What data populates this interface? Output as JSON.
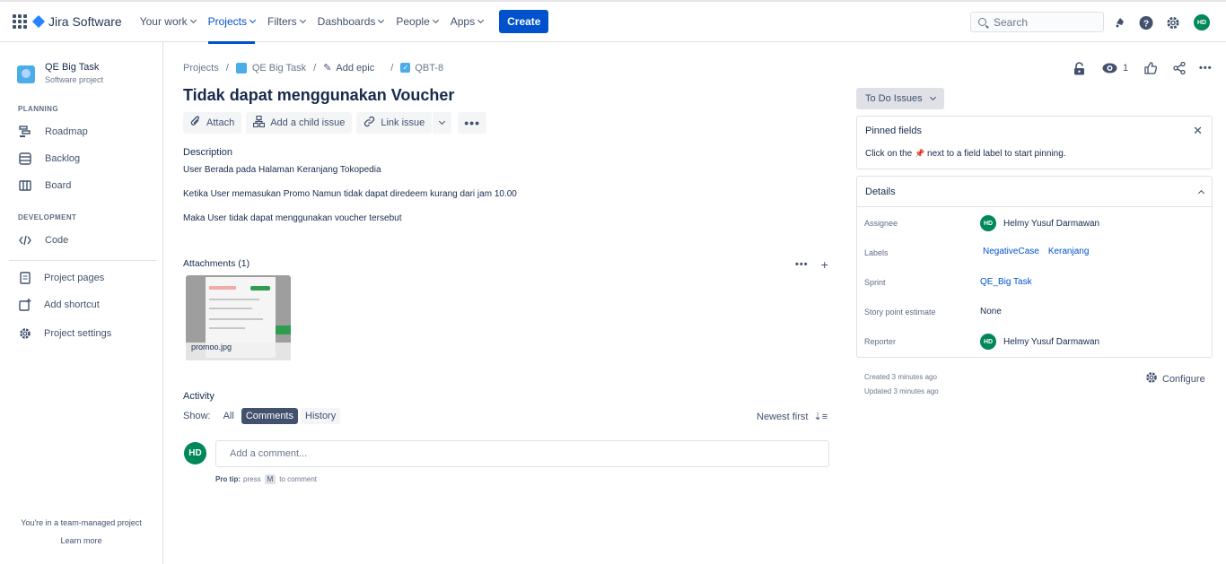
{
  "nav": {
    "product": "Jira Software",
    "items": [
      "Your work",
      "Projects",
      "Filters",
      "Dashboards",
      "People",
      "Apps"
    ],
    "create_label": "Create",
    "search_placeholder": "Search",
    "user_initials": "HD"
  },
  "sidebar": {
    "project_name": "QE Big Task",
    "project_type": "Software project",
    "planning_header": "PLANNING",
    "planning_items": [
      "Roadmap",
      "Backlog",
      "Board"
    ],
    "development_header": "DEVELOPMENT",
    "development_items": [
      "Code"
    ],
    "other_items": [
      "Project pages",
      "Add shortcut",
      "Project settings"
    ],
    "footer_text": "You're in a team-managed project",
    "learn_more": "Learn more"
  },
  "breadcrumb": {
    "root": "Projects",
    "project": "QE Big Task",
    "epic": "Add epic",
    "issue_key": "QBT-8"
  },
  "issue": {
    "title": "Tidak dapat menggunakan Voucher",
    "toolbar": [
      "Attach",
      "Add a child issue",
      "Link issue"
    ],
    "description_label": "Description",
    "description_lines": [
      "User Berada pada Halaman Keranjang Tokopedia",
      "Ketika User memasukan Promo Namun tidak dapat diredeem kurang dari jam 10.00",
      "Maka User tidak dapat menggunakan voucher tersebut"
    ],
    "attachments_label": "Attachments (1)",
    "attachment_file": "promoo.jpg"
  },
  "activity": {
    "label": "Activity",
    "show_label": "Show:",
    "filters": [
      "All",
      "Comments",
      "History"
    ],
    "selected_filter": "Comments",
    "sort_label": "Newest first",
    "comment_placeholder": "Add a comment...",
    "protip_bold": "Pro tip:",
    "protip_press": "press",
    "protip_key": "M",
    "protip_rest": "to comment"
  },
  "right": {
    "watchers_count": "1",
    "status_label": "To Do Issues",
    "pinned_title": "Pinned fields",
    "pinned_hint_pre": "Click on the",
    "pinned_hint_post": "next to a field label to start pinning.",
    "details_title": "Details",
    "fields": {
      "assignee_label": "Assignee",
      "assignee": "Helmy Yusuf Darmawan",
      "labels_label": "Labels",
      "labels": [
        "NegativeCase",
        "Keranjang"
      ],
      "sprint_label": "Sprint",
      "sprint": "QE_Big Task",
      "story_points_label": "Story point estimate",
      "story_points": "None",
      "reporter_label": "Reporter",
      "reporter": "Helmy Yusuf Darmawan",
      "avatar_initials": "HD"
    },
    "created": "Created 3 minutes ago",
    "updated": "Updated 3 minutes ago",
    "configure": "Configure"
  },
  "colors": {
    "accent": "#0052cc",
    "avatar": "#00875a",
    "project_icon": "#4bade8"
  }
}
